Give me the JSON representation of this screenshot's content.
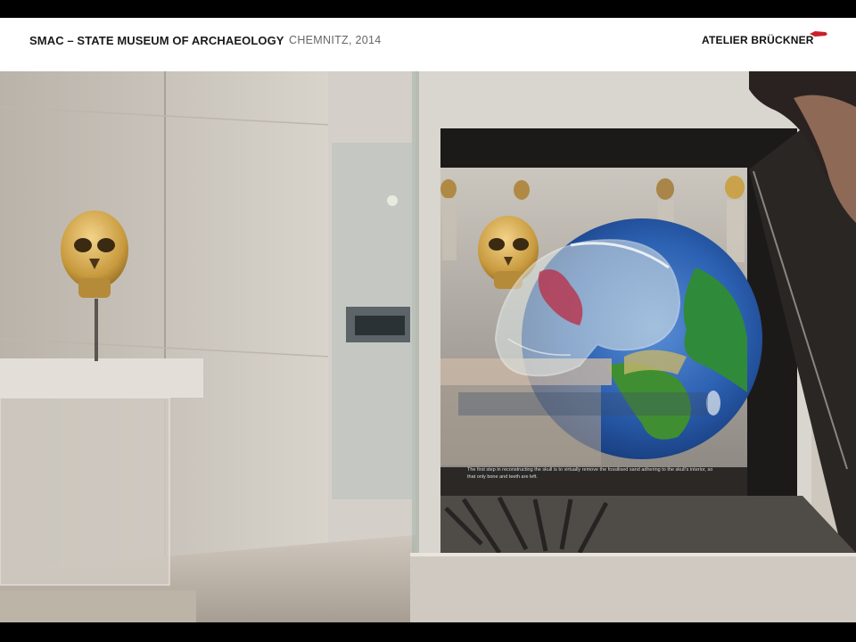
{
  "header": {
    "title": "SMAC – STATE MUSEUM OF ARCHAEOLOGY",
    "subtitle": "CHEMNITZ, 2014",
    "brand": "ATELIER BRÜCKNER"
  },
  "scene": {
    "screen_caption": "The first step in reconstructing the skull is to virtually remove the fossilised sand adhering to the skull's interior, so that only bone and teeth are left."
  },
  "colors": {
    "brand_accent": "#c8202a",
    "header_bg": "#ffffff",
    "frame": "#000000"
  }
}
